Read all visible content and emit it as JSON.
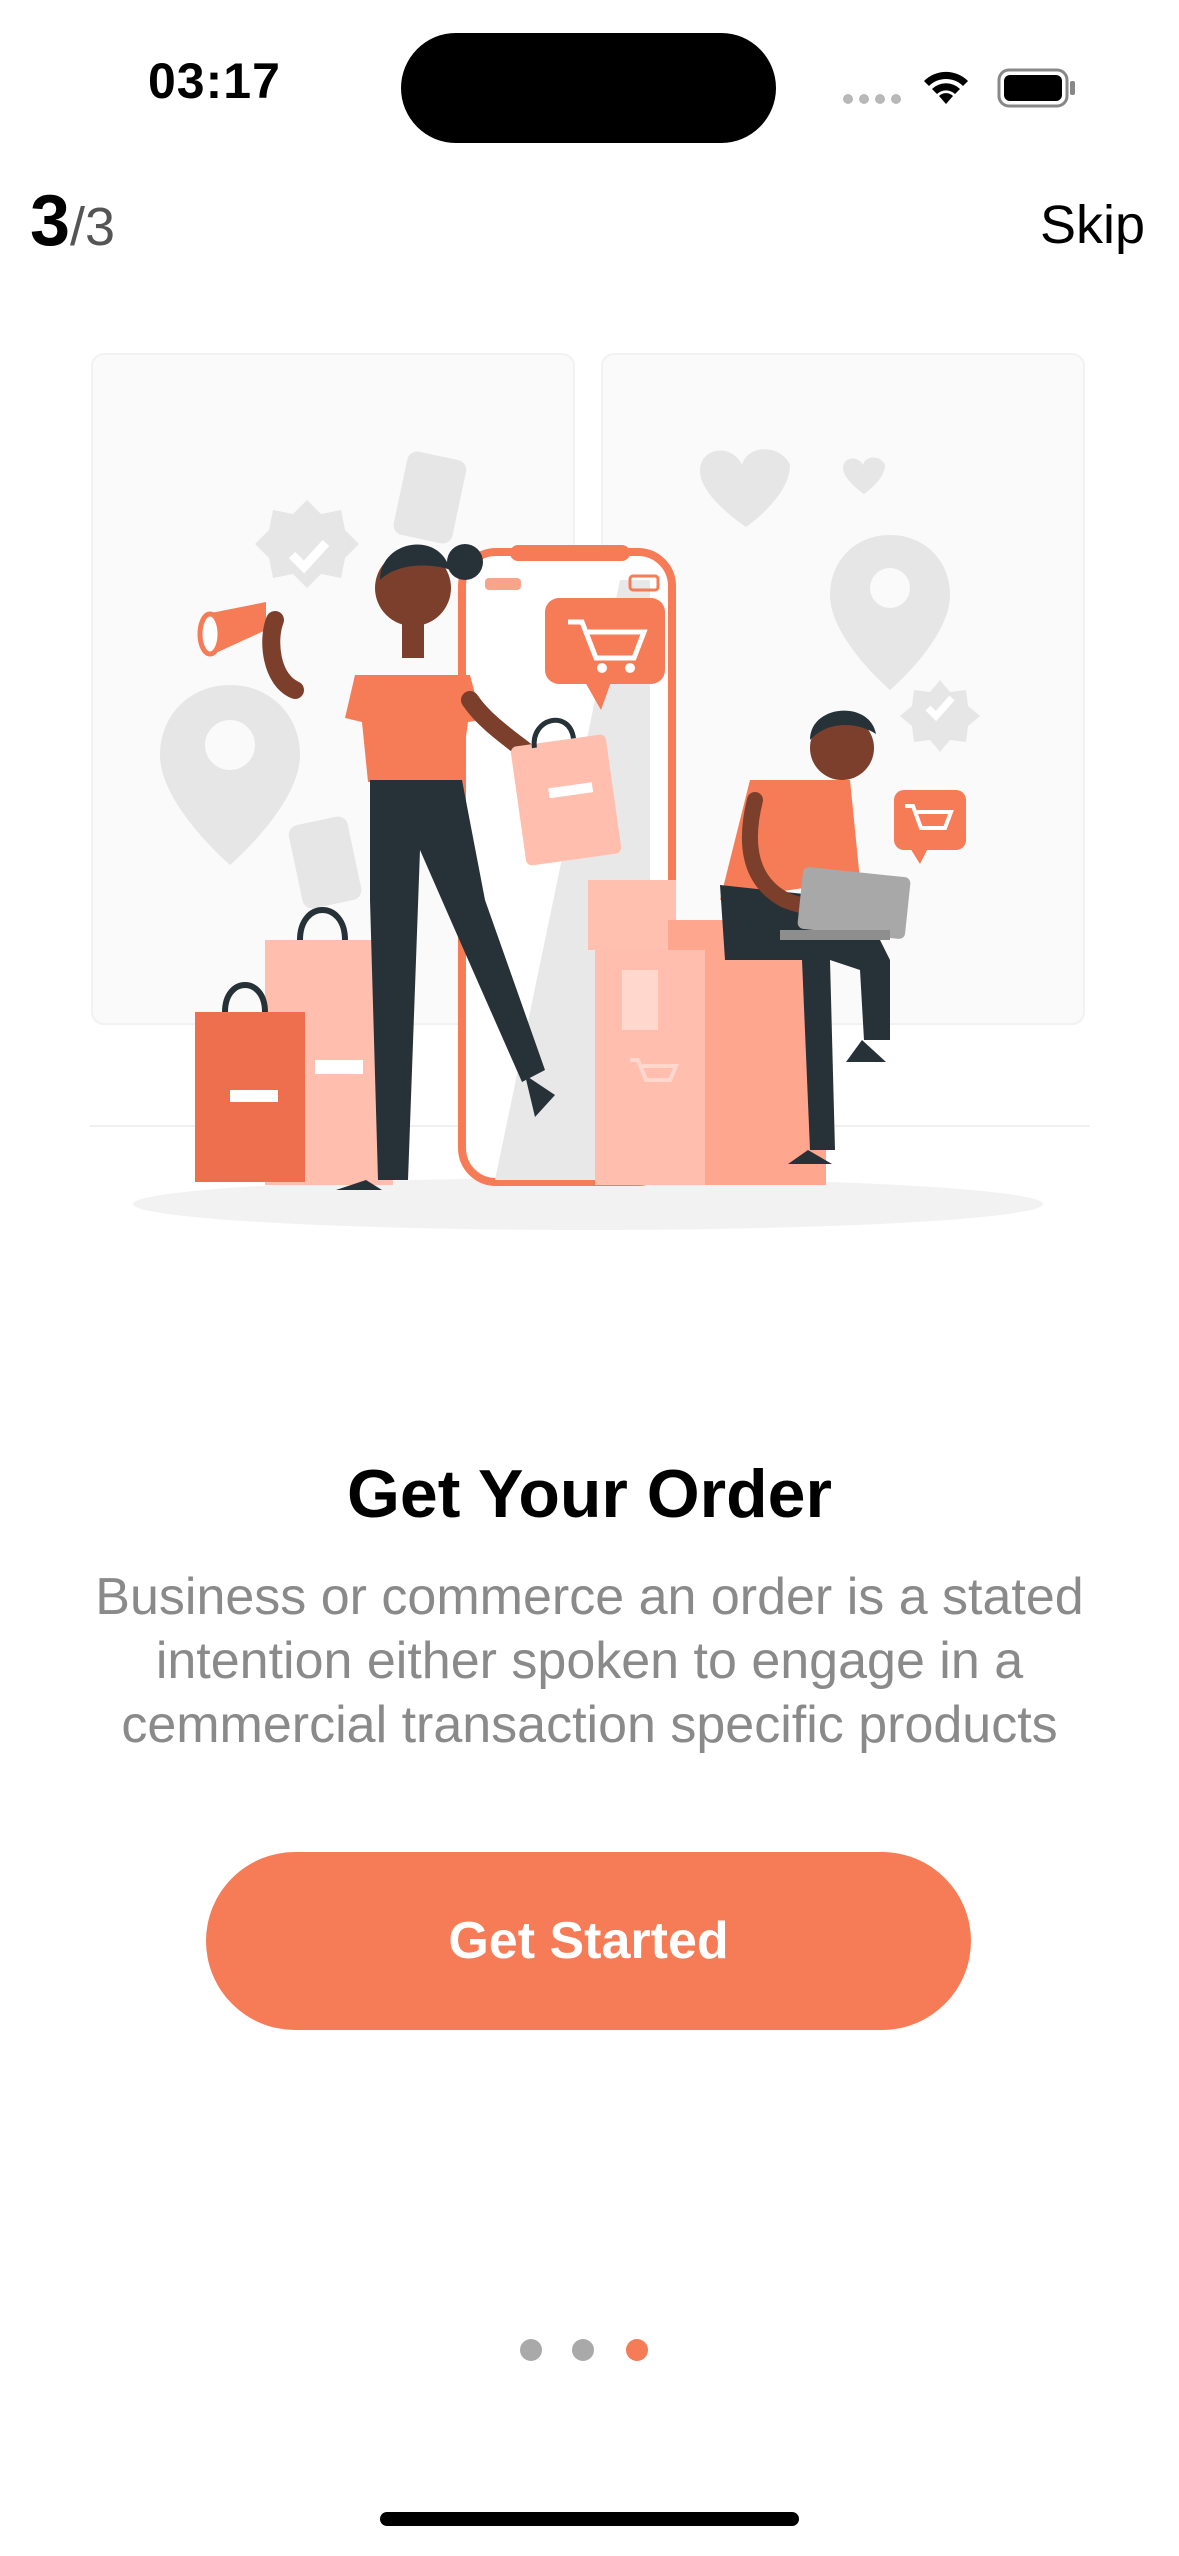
{
  "status_bar": {
    "time": "03:17"
  },
  "pager": {
    "current": "3",
    "total": "/3"
  },
  "header": {
    "skip_label": "Skip"
  },
  "onboarding": {
    "title": "Get Your Order",
    "description": "Business or commerce an order is a stated intention either spoken to engage in a cemmercial transaction specific products",
    "cta_label": "Get Started"
  },
  "page_indicator": {
    "count": 3,
    "active_index": 2
  },
  "colors": {
    "accent": "#f57c56",
    "inactive_dot": "#a9a9a9",
    "dark": "#263238"
  }
}
